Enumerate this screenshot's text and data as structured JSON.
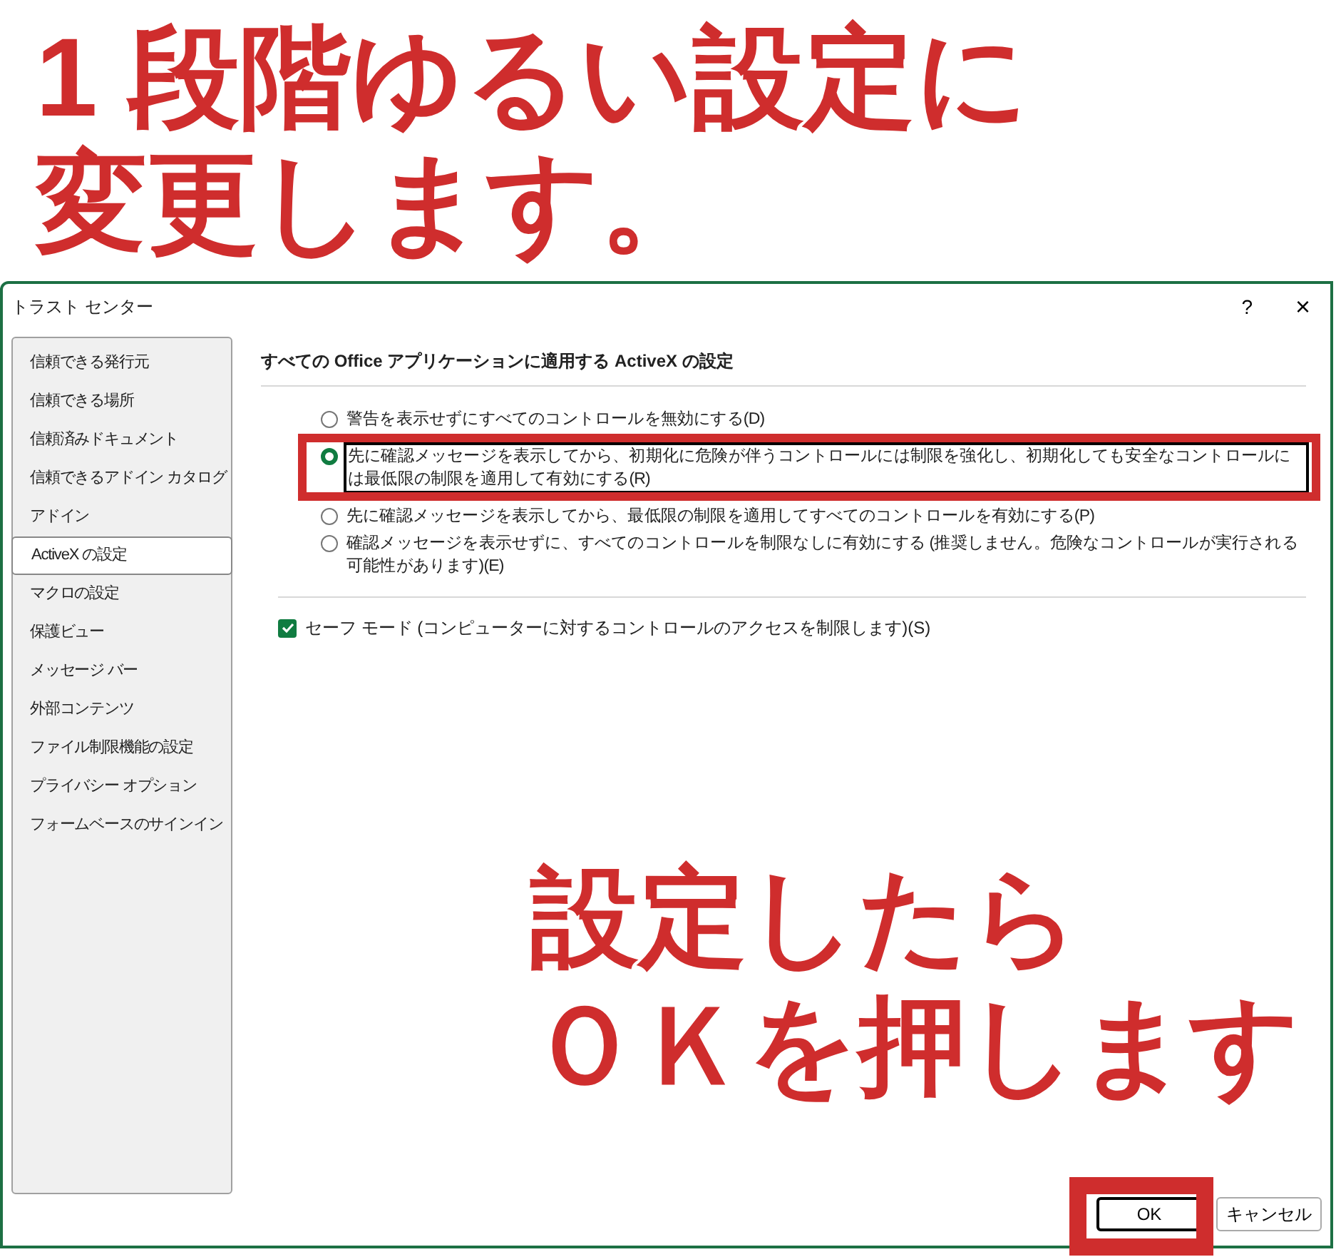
{
  "callout_top": {
    "lines": [
      "1 段階ゆるい設定に",
      "変更します。"
    ]
  },
  "dialog": {
    "title": "トラスト センター",
    "help": "?",
    "close": "×",
    "sidebar": {
      "items": [
        {
          "label": "信頼できる発行元",
          "selected": false
        },
        {
          "label": "信頼できる場所",
          "selected": false
        },
        {
          "label": "信頼済みドキュメント",
          "selected": false
        },
        {
          "label": "信頼できるアドイン カタログ",
          "selected": false
        },
        {
          "label": "アドイン",
          "selected": false
        },
        {
          "label": "ActiveX の設定",
          "selected": true
        },
        {
          "label": "マクロの設定",
          "selected": false
        },
        {
          "label": "保護ビュー",
          "selected": false
        },
        {
          "label": "メッセージ バー",
          "selected": false
        },
        {
          "label": "外部コンテンツ",
          "selected": false
        },
        {
          "label": "ファイル制限機能の設定",
          "selected": false
        },
        {
          "label": "プライバシー オプション",
          "selected": false
        },
        {
          "label": "フォームベースのサインイン",
          "selected": false
        }
      ]
    },
    "section_title": "すべての Office アプリケーションに適用する ActiveX の設定",
    "options": [
      {
        "label": "警告を表示せずにすべてのコントロールを無効にする(D)",
        "selected": false,
        "focused": false,
        "highlighted": false
      },
      {
        "label": "先に確認メッセージを表示してから、初期化に危険が伴うコントロールには制限を強化し、初期化しても安全なコントロールには最低限の制限を適用して有効にする(R)",
        "selected": true,
        "focused": true,
        "highlighted": true
      },
      {
        "label": "先に確認メッセージを表示してから、最低限の制限を適用してすべてのコントロールを有効にする(P)",
        "selected": false,
        "focused": false,
        "highlighted": false
      },
      {
        "label": "確認メッセージを表示せずに、すべてのコントロールを制限なしに有効にする (推奨しません。危険なコントロールが実行される可能性があります)(E)",
        "selected": false,
        "focused": false,
        "highlighted": false
      }
    ],
    "safe_mode": {
      "label": "セーフ モード (コンピューターに対するコントロールのアクセスを制限します)(S)",
      "checked": true
    },
    "buttons": [
      {
        "label": "OK",
        "default": true,
        "highlighted": true
      },
      {
        "label": "キャンセル",
        "default": false,
        "highlighted": false
      }
    ]
  },
  "callout_bottom": {
    "lines": [
      "設定したら",
      "ＯＫを押します"
    ]
  }
}
